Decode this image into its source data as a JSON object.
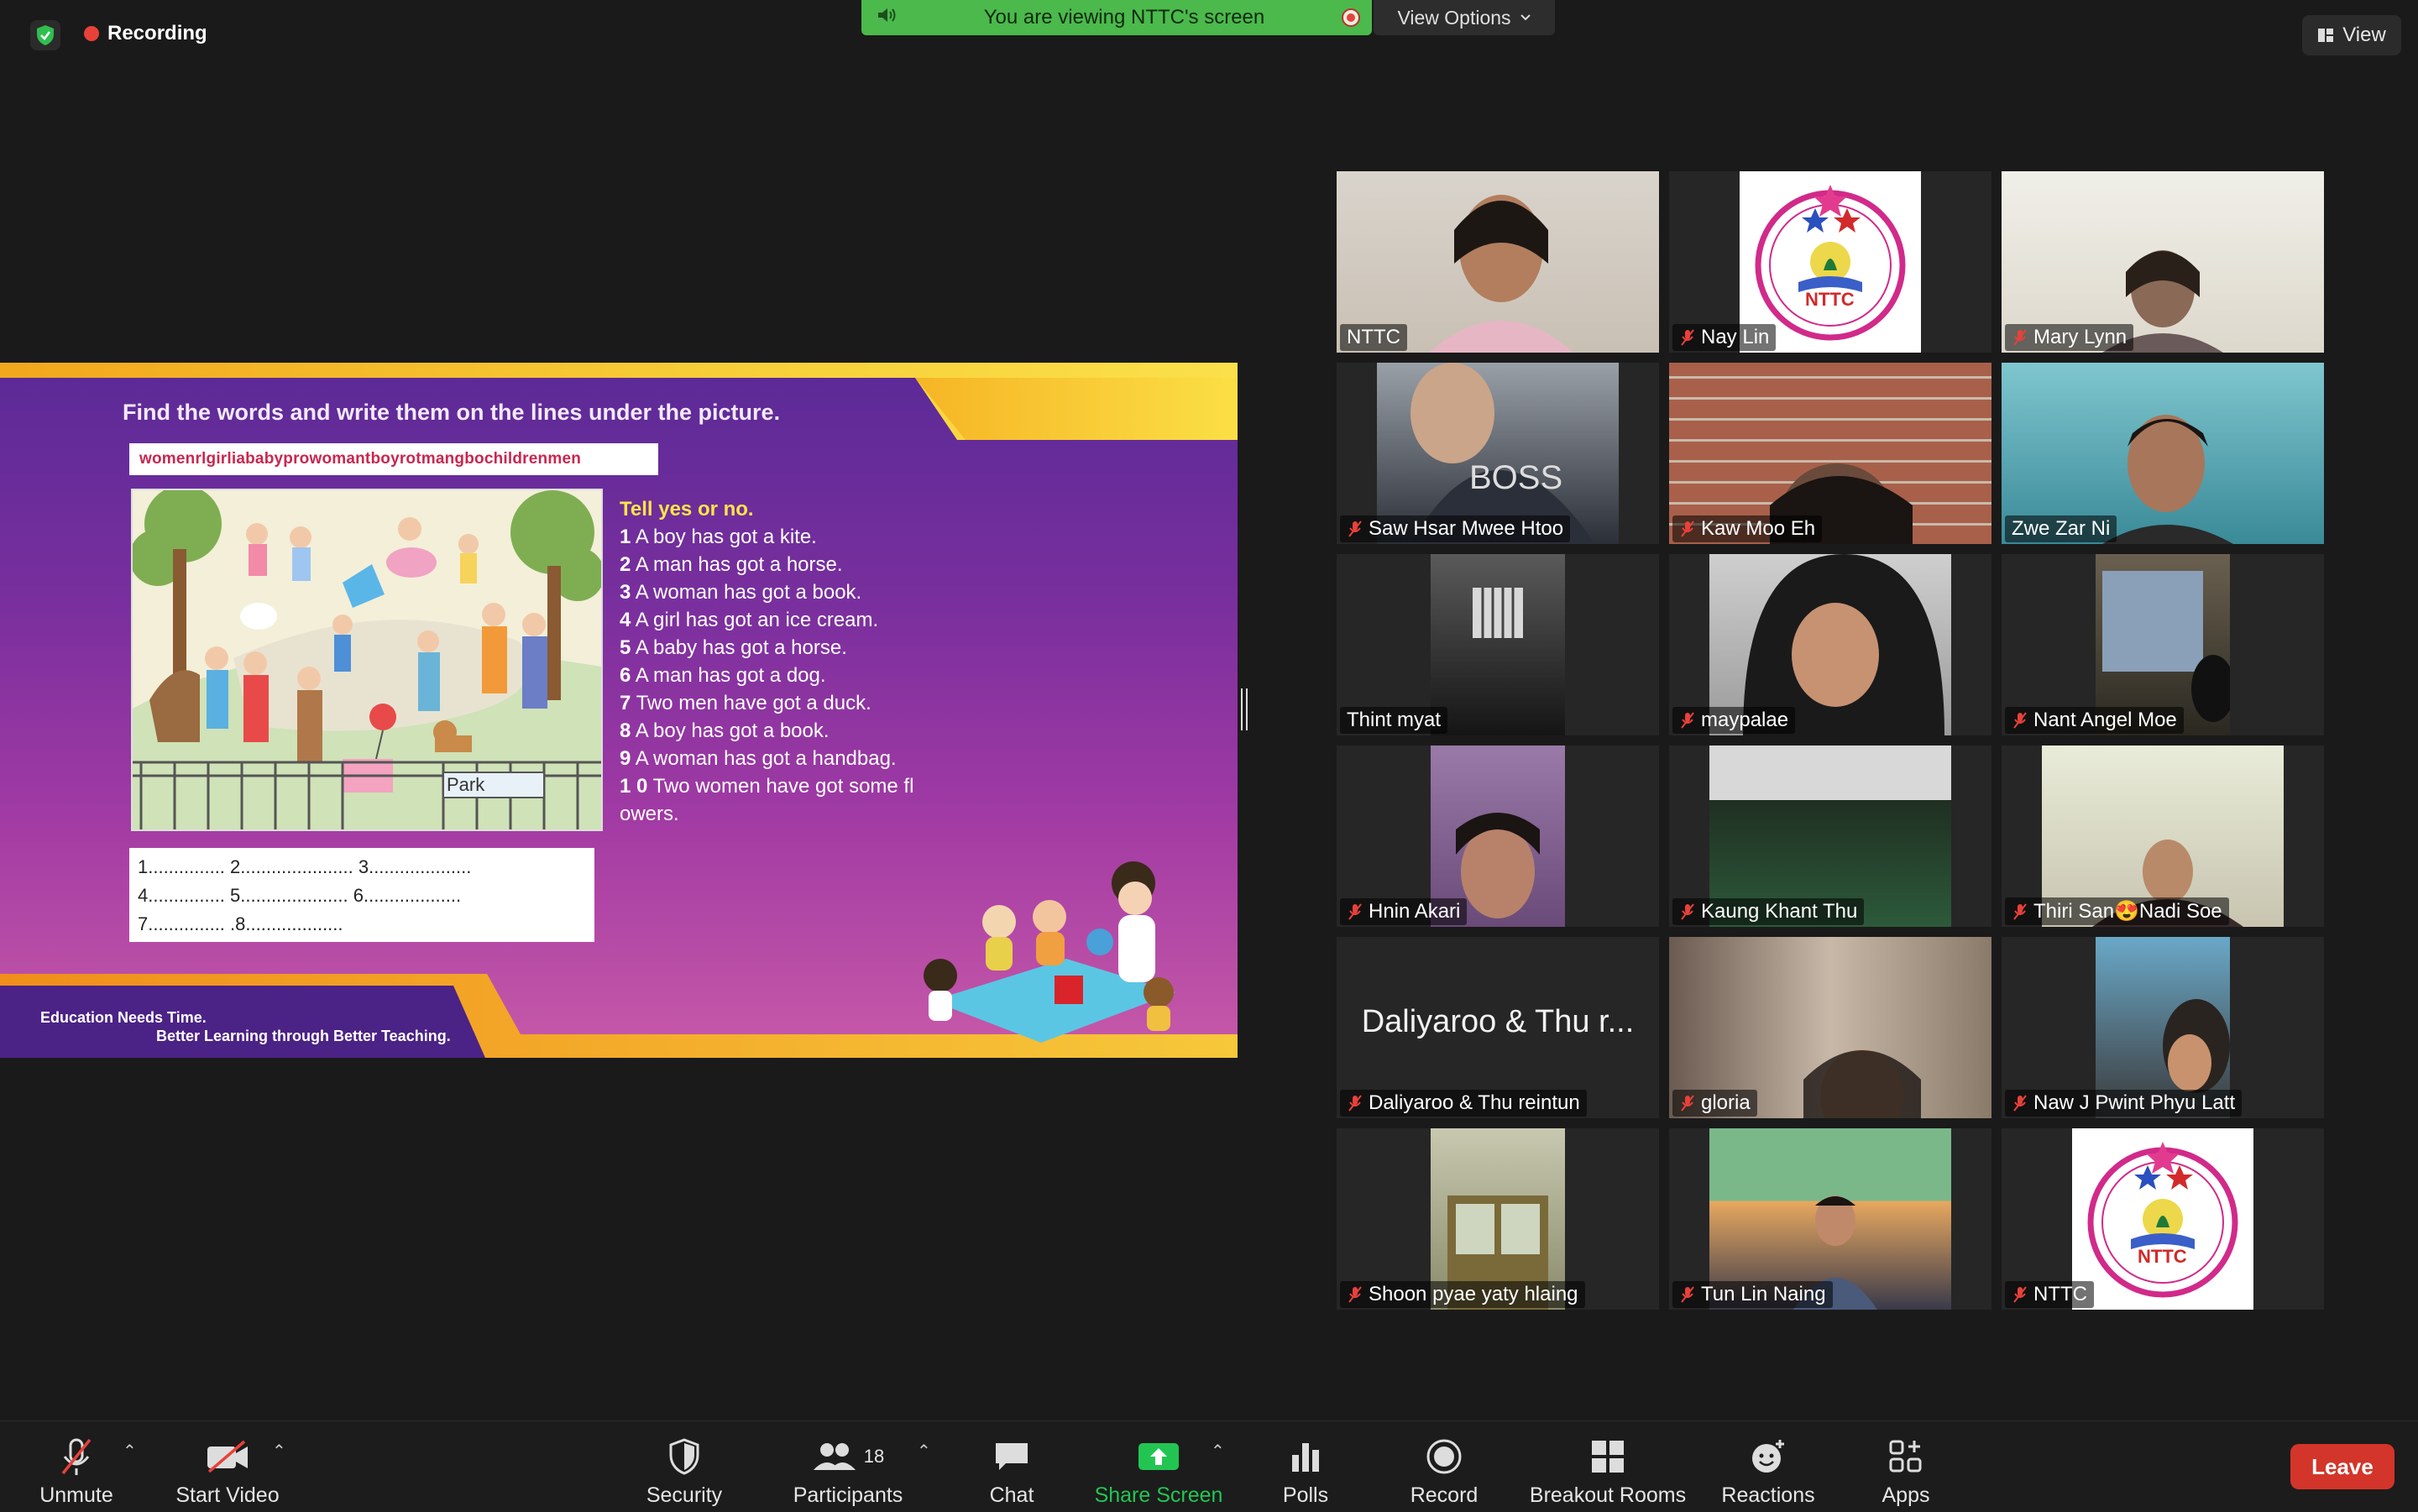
{
  "topbar": {
    "recording_label": "Recording",
    "banner_text": "You are viewing NTTC's screen",
    "view_options_label": "View Options",
    "view_label": "View"
  },
  "slide": {
    "title": "Find the words and write them on the lines under the picture.",
    "word_string": "womenrlgirliababyprowomantboyrotmangbochildrenmen",
    "picture_sign": "Park",
    "answer_lines": [
      "1............... 2...................... 3....................",
      "4............... 5..................... 6...................",
      "7............... .8..................."
    ],
    "tell_heading": "Tell yes or no.",
    "statements": [
      {
        "num": "1",
        "text": "A boy has got a kite."
      },
      {
        "num": "2",
        "text": "A man has got a horse."
      },
      {
        "num": "3",
        "text": "A woman has got a book."
      },
      {
        "num": "4",
        "text": "A girl has got an ice cream."
      },
      {
        "num": "5",
        "text": "A baby has got a horse."
      },
      {
        "num": "6",
        "text": "A man has got a dog."
      },
      {
        "num": "7",
        "text": "Two men have got a duck."
      },
      {
        "num": "8",
        "text": "A boy has got a book."
      },
      {
        "num": "9",
        "text": "A woman has got a handbag."
      },
      {
        "num": "1 0",
        "text": "Two women have got some fl owers."
      }
    ],
    "slogan_1": "Education Needs Time.",
    "slogan_2": "Better Learning through Better Teaching."
  },
  "logo": {
    "text": "NTTC",
    "ring_text": "New Teacher Training Center"
  },
  "participants": [
    {
      "name": "NTTC",
      "muted": false
    },
    {
      "name": "Nay Lin",
      "muted": true
    },
    {
      "name": "Mary Lynn",
      "muted": true
    },
    {
      "name": "Saw Hsar Mwee Htoo",
      "muted": true
    },
    {
      "name": "Kaw Moo Eh",
      "muted": true
    },
    {
      "name": "Zwe Zar Ni",
      "muted": false
    },
    {
      "name": "Thint myat",
      "muted": false
    },
    {
      "name": "maypalae",
      "muted": true
    },
    {
      "name": "Nant Angel Moe",
      "muted": true
    },
    {
      "name": "Hnin Akari",
      "muted": true
    },
    {
      "name": "Kaung Khant Thu",
      "muted": true
    },
    {
      "name": "Thiri San😍Nadi Soe",
      "muted": true
    },
    {
      "name": "Daliyaroo & Thu reintun",
      "muted": true,
      "display_name": "Daliyaroo & Thu r..."
    },
    {
      "name": "gloria",
      "muted": true
    },
    {
      "name": "Naw J Pwint Phyu Latt",
      "muted": true
    },
    {
      "name": "Shoon pyae yaty hlaing",
      "muted": true
    },
    {
      "name": "Tun Lin Naing",
      "muted": true
    },
    {
      "name": "NTTC",
      "muted": true
    }
  ],
  "toolbar": {
    "unmute": "Unmute",
    "start_video": "Start Video",
    "security": "Security",
    "participants": "Participants",
    "participants_count": "18",
    "chat": "Chat",
    "share_screen": "Share Screen",
    "polls": "Polls",
    "record": "Record",
    "breakout_rooms": "Breakout Rooms",
    "reactions": "Reactions",
    "apps": "Apps",
    "leave": "Leave"
  },
  "colors": {
    "banner_green": "#4bb94b",
    "share_green": "#23c552",
    "leave_red": "#d3352a",
    "muted_red": "#e8413a"
  }
}
